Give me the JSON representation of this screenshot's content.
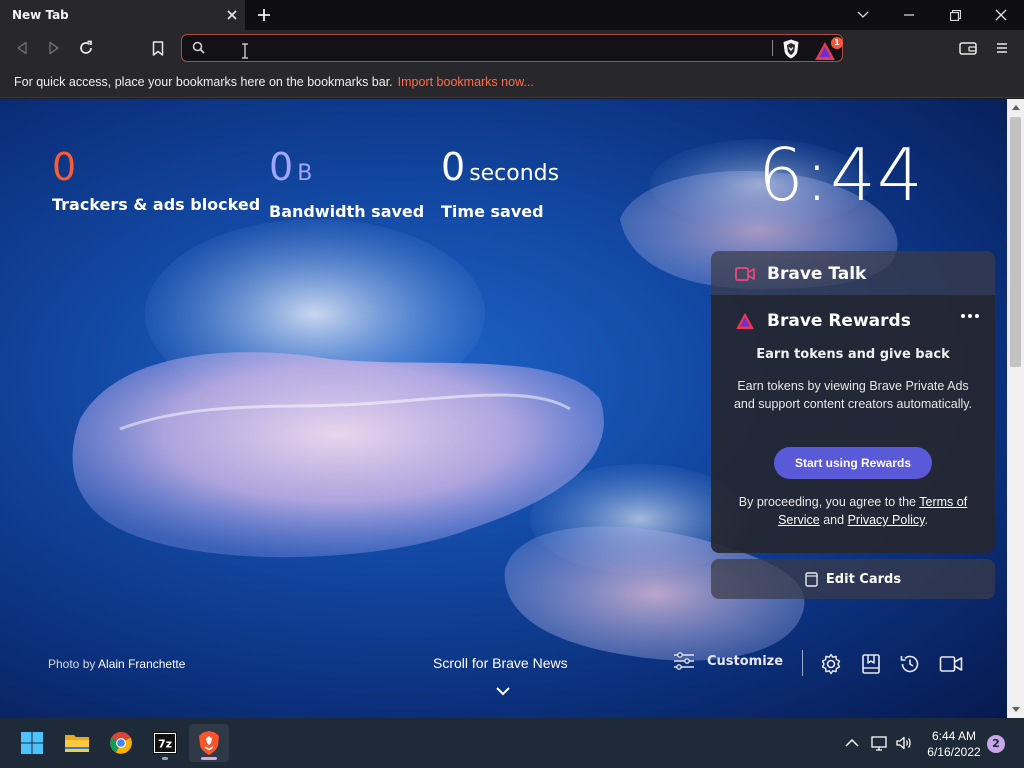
{
  "browser": {
    "tab": {
      "title": "New Tab"
    },
    "omnibox": {
      "value": "",
      "placeholder": ""
    },
    "rewards_badge": "1",
    "bookmarks_bar": {
      "hint": "For quick access, place your bookmarks here on the bookmarks bar.",
      "import_link": "Import bookmarks now..."
    }
  },
  "new_tab": {
    "stats": [
      {
        "value": "0",
        "unit": "",
        "label": "Trackers & ads blocked",
        "color": "#fb5b34"
      },
      {
        "value": "0",
        "unit": "B",
        "label": "Bandwidth saved",
        "color": "#a0a5ff"
      },
      {
        "value": "0",
        "unit": "seconds",
        "label": "Time saved",
        "color": "#ffffff"
      }
    ],
    "clock": "6:44",
    "cards": {
      "talk_title": "Brave Talk",
      "rewards_title": "Brave Rewards",
      "rewards_subtitle": "Earn tokens and give back",
      "rewards_body": "Earn tokens by viewing Brave Private Ads and support content creators automatically.",
      "rewards_button": "Start using Rewards",
      "legal_prefix": "By proceeding, you agree to the",
      "legal_terms": "Terms of Service",
      "legal_and": "and",
      "legal_privacy": "Privacy Policy",
      "legal_suffix": ".",
      "edit_cards": "Edit Cards"
    },
    "photo_credit_prefix": "Photo by",
    "photo_credit_name": "Alain Franchette",
    "scroll_news": "Scroll for Brave News",
    "customize": "Customize"
  },
  "taskbar": {
    "time": "6:44 AM",
    "date": "6/16/2022",
    "notification_count": "2",
    "apps": [
      "windows-start-icon",
      "file-explorer-icon",
      "chrome-icon",
      "7zip-icon",
      "brave-icon"
    ]
  },
  "colors": {
    "accent_orange": "#fb6f4f",
    "rewards_button": "#5a59d8",
    "omnibox_border": "#b24c3d"
  }
}
